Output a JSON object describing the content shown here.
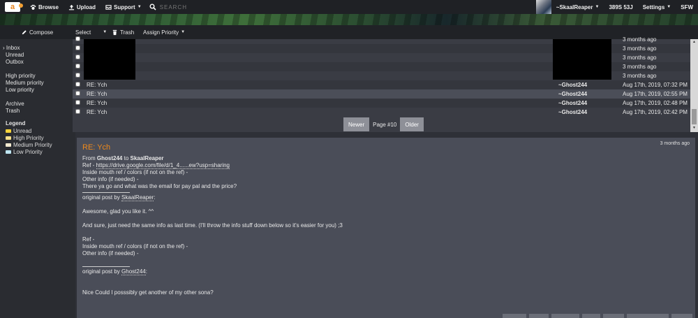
{
  "nav": {
    "logo": "a",
    "browse": "Browse",
    "upload": "Upload",
    "support": "Support",
    "search_placeholder": "SEARCH",
    "username": "~SkaalReaper",
    "notifications": "389S 53J",
    "settings": "Settings",
    "rating": "SFW"
  },
  "toolbar": {
    "compose": "Compose",
    "select": "Select",
    "trash": "Trash",
    "assign_priority": "Assign Priority"
  },
  "sidebar": {
    "folders": [
      "Inbox",
      "Unread",
      "Outbox"
    ],
    "priorities": [
      "High priority",
      "Medium priority",
      "Low priority"
    ],
    "other": [
      "Archive",
      "Trash"
    ],
    "legend_title": "Legend",
    "legend": [
      {
        "label": "Unread",
        "color": "#f5d23a"
      },
      {
        "label": "High Priority",
        "color": "#f7e08a"
      },
      {
        "label": "Medium Priority",
        "color": "#f3ead0"
      },
      {
        "label": "Low Priority",
        "color": "#bfe6f2"
      }
    ]
  },
  "messages": [
    {
      "subject": "",
      "from": "",
      "date": "3 months ago"
    },
    {
      "subject": "",
      "from": "",
      "date": "3 months ago"
    },
    {
      "subject": "",
      "from": "",
      "date": "3 months ago"
    },
    {
      "subject": "",
      "from": "",
      "date": "3 months ago"
    },
    {
      "subject": "",
      "from": "",
      "date": "3 months ago"
    },
    {
      "subject": "RE: Ych",
      "from": "~Ghost244",
      "date": "Aug 17th, 2019, 07:32 PM"
    },
    {
      "subject": "RE: Ych",
      "from": "~Ghost244",
      "date": "Aug 17th, 2019, 02:55 PM"
    },
    {
      "subject": "RE: Ych",
      "from": "~Ghost244",
      "date": "Aug 17th, 2019, 02:48 PM"
    },
    {
      "subject": "RE: Ych",
      "from": "~Ghost244",
      "date": "Aug 17th, 2019, 02:42 PM"
    }
  ],
  "pager": {
    "newer": "Newer",
    "current": "Page #10",
    "older": "Older"
  },
  "message": {
    "title": "RE: Ych",
    "date": "3 months ago",
    "from_prefix": "From",
    "from": "Ghost244",
    "to_prefix": "to",
    "to": "SkaalReaper",
    "ref_prefix": "Ref - ",
    "ref_link": "https://drive.google.com/file/d/1_4......ew?usp=sharing",
    "line_mouth": "Inside mouth ref / colors (if not on the ref) -",
    "line_other": "Other info (if needed) -",
    "line_question": "There ya go and what was the email for pay pal and the price?",
    "quote1_prefix": "original post by",
    "quote1_author": "SkaalReaper",
    "quote1_suffix": ":",
    "quote1_line1": "Awesome, glad you like it. ^^",
    "quote1_line2": "And sure, just need the same info as last time. (I'll throw the info stuff down below so it's easier for you) ;3",
    "quote1_ref": "Ref -",
    "quote1_mouth": "Inside mouth ref / colors (if not on the ref) -",
    "quote1_other": "Other info (if needed) -",
    "quote2_prefix": "original post by",
    "quote2_author": "Ghost244",
    "quote2_suffix": ":",
    "quote2_line1": "Nice Could I posssibly get another of my other sona?"
  }
}
